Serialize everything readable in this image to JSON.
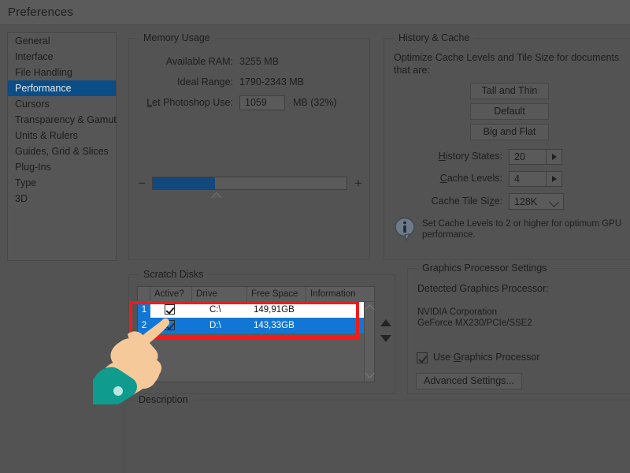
{
  "window": {
    "title": "Preferences"
  },
  "sidebar": {
    "items": [
      {
        "label": "General",
        "selected": false
      },
      {
        "label": "Interface",
        "selected": false
      },
      {
        "label": "File Handling",
        "selected": false
      },
      {
        "label": "Performance",
        "selected": true
      },
      {
        "label": "Cursors",
        "selected": false
      },
      {
        "label": "Transparency & Gamut",
        "selected": false
      },
      {
        "label": "Units & Rulers",
        "selected": false
      },
      {
        "label": "Guides, Grid & Slices",
        "selected": false
      },
      {
        "label": "Plug-Ins",
        "selected": false
      },
      {
        "label": "Type",
        "selected": false
      },
      {
        "label": "3D",
        "selected": false
      }
    ]
  },
  "memory_usage": {
    "legend": "Memory Usage",
    "available_ram_label": "Available RAM:",
    "available_ram_value": "3255 MB",
    "ideal_range_label": "Ideal Range:",
    "ideal_range_value": "1790-2343 MB",
    "let_photoshop_use_label": "Let Photoshop Use:",
    "let_photoshop_use_value": "1059",
    "mb_percent_suffix": "MB (32%)",
    "minus_label": "−",
    "plus_label": "+",
    "slider_fill_percent": 32
  },
  "history_cache": {
    "legend": "History & Cache",
    "intro": "Optimize Cache Levels and Tile Size for documents that are:",
    "preset_tall_thin": "Tall and Thin",
    "preset_default": "Default",
    "preset_big_flat": "Big and Flat",
    "history_states_label": "History States:",
    "history_states_value": "20",
    "cache_levels_label": "Cache Levels:",
    "cache_levels_value": "4",
    "cache_tile_size_label": "Cache Tile Size:",
    "cache_tile_size_value": "128K",
    "note": "Set Cache Levels to 2 or higher for optimum GPU performance."
  },
  "scratch_disks": {
    "legend": "Scratch Disks",
    "columns": [
      "",
      "Active?",
      "Drive",
      "Free Space",
      "Information"
    ],
    "rows": [
      {
        "num": "1",
        "active": true,
        "drive": "C:\\",
        "free_space": "149,91GB",
        "information": "",
        "selected": false
      },
      {
        "num": "2",
        "active": true,
        "drive": "D:\\",
        "free_space": "143,33GB",
        "information": "",
        "selected": true
      }
    ],
    "highlight_color": "#ee1c1c",
    "selection_color": "#1277d4"
  },
  "graphics_processor": {
    "legend": "Graphics Processor Settings",
    "detected_label": "Detected Graphics Processor:",
    "vendor": "NVIDIA Corporation",
    "model": "GeForce MX230/PCIe/SSE2",
    "use_gpu_label": "Use Graphics Processor",
    "use_gpu_checked": true,
    "advanced_button": "Advanced Settings..."
  },
  "description": {
    "legend": "Description",
    "text": ""
  },
  "colors": {
    "dialog_bg": "#535353",
    "titlebar_bg": "#5b5b5b",
    "selected_nav": "#0b4d86",
    "slider_fill": "#12487c",
    "row_selected": "#1277d4",
    "highlight_border": "#ee1c1c",
    "hand_skin": "#f6c99a",
    "hand_sleeve": "#0f9b8e"
  }
}
